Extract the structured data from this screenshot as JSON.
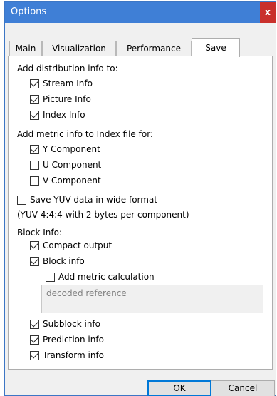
{
  "window": {
    "title": "Options",
    "close_label": "x"
  },
  "tabs": [
    {
      "label": "Main"
    },
    {
      "label": "Visualization"
    },
    {
      "label": "Performance"
    },
    {
      "label": "Save"
    }
  ],
  "active_tab": "Save",
  "distribution": {
    "header": "Add distribution info to:",
    "items": [
      {
        "label": "Stream Info",
        "checked": true
      },
      {
        "label": "Picture Info",
        "checked": true
      },
      {
        "label": "Index Info",
        "checked": true
      }
    ]
  },
  "metric": {
    "header": "Add metric info to Index file for:",
    "items": [
      {
        "label": "Y Component",
        "checked": true
      },
      {
        "label": "U Component",
        "checked": false
      },
      {
        "label": "V Component",
        "checked": false
      }
    ]
  },
  "yuv": {
    "label": "Save YUV data in wide format",
    "checked": false,
    "note": "(YUV 4:4:4 with 2 bytes per component)"
  },
  "block": {
    "header": "Block Info:",
    "compact": {
      "label": "Compact output",
      "checked": true
    },
    "block_info": {
      "label": "Block info",
      "checked": true
    },
    "metric_calc": {
      "label": "Add metric calculation",
      "checked": false
    },
    "reference_placeholder": "decoded reference",
    "subblock": {
      "label": "Subblock info",
      "checked": true
    },
    "prediction": {
      "label": "Prediction info",
      "checked": true
    },
    "transform": {
      "label": "Transform info",
      "checked": true
    }
  },
  "buttons": {
    "ok": "OK",
    "cancel": "Cancel"
  }
}
